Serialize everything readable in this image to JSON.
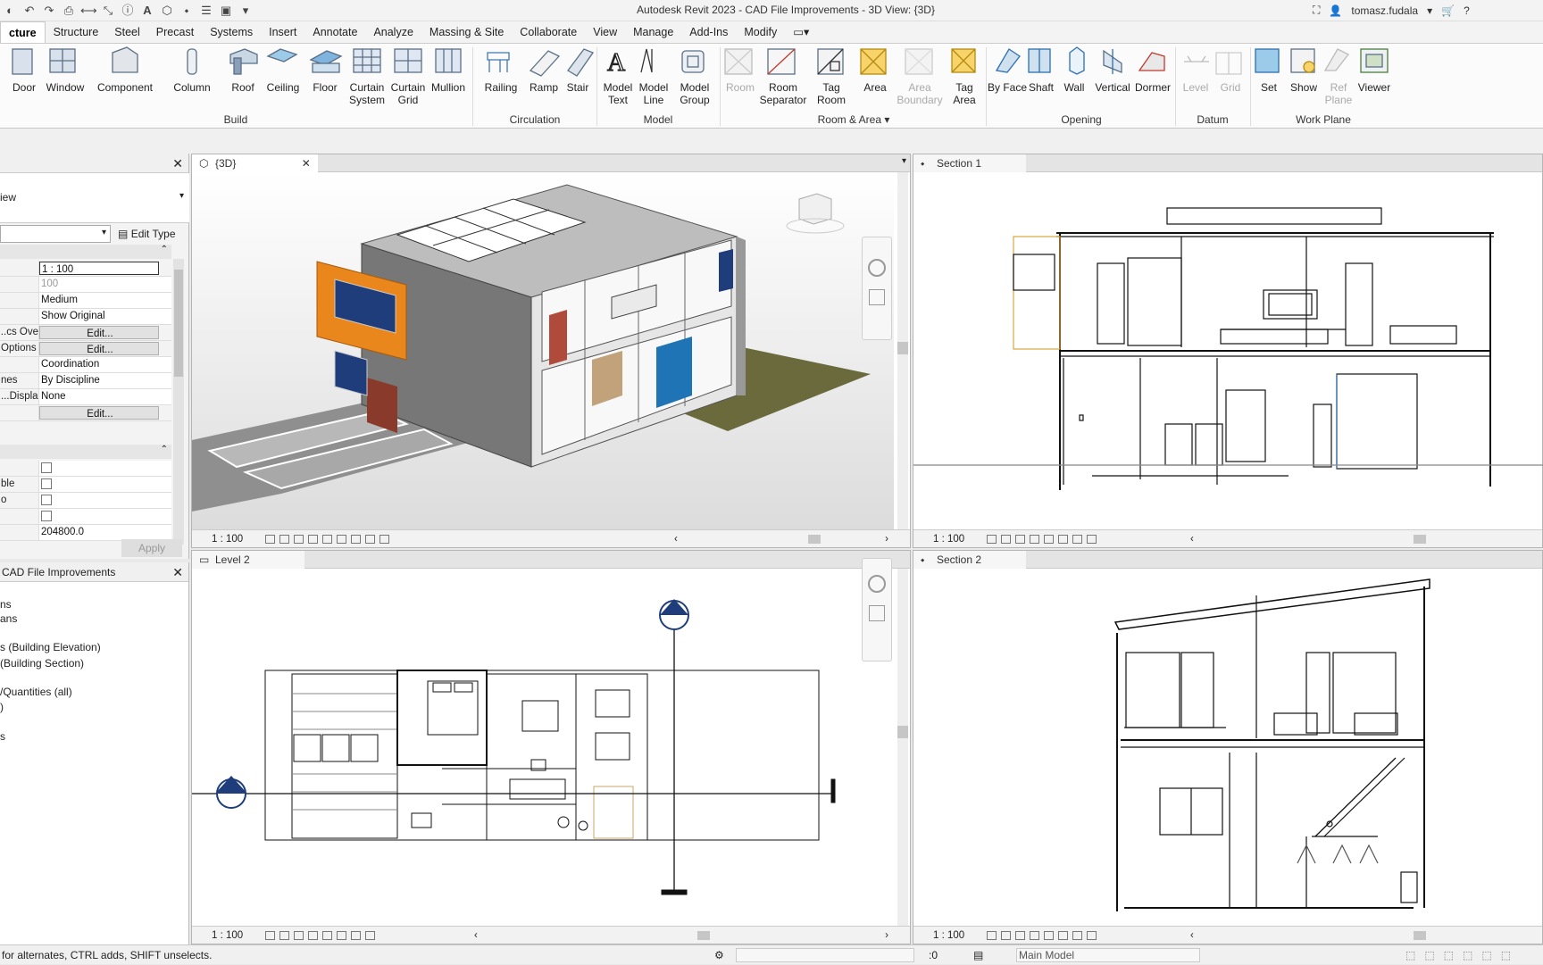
{
  "window": {
    "title": "Autodesk Revit 2023 - CAD File Improvements - 3D View: {3D}",
    "user": "tomasz.fudala"
  },
  "tabs": [
    "cture",
    "Structure",
    "Steel",
    "Precast",
    "Systems",
    "Insert",
    "Annotate",
    "Analyze",
    "Massing & Site",
    "Collaborate",
    "View",
    "Manage",
    "Add-Ins",
    "Modify"
  ],
  "ribbon": {
    "build": {
      "label": "Build",
      "items": [
        "Door",
        "Window",
        "Component",
        "Column",
        "Roof",
        "Ceiling",
        "Floor",
        "Curtain System",
        "Curtain Grid",
        "Mullion"
      ]
    },
    "circulation": {
      "label": "Circulation",
      "items": [
        "Railing",
        "Ramp",
        "Stair"
      ]
    },
    "model": {
      "label": "Model",
      "items": [
        "Model Text",
        "Model Line",
        "Model Group"
      ]
    },
    "room_area": {
      "label": "Room & Area",
      "items": [
        "Room",
        "Room Separator",
        "Tag Room",
        "Area",
        "Area Boundary",
        "Tag Area"
      ]
    },
    "opening": {
      "label": "Opening",
      "items": [
        "By Face",
        "Shaft",
        "Wall",
        "Vertical",
        "Dormer"
      ]
    },
    "datum": {
      "label": "Datum",
      "items": [
        "Level",
        "Grid"
      ]
    },
    "work_plane": {
      "label": "Work Plane",
      "items": [
        "Set",
        "Show",
        "Ref Plane",
        "Viewer"
      ]
    }
  },
  "properties": {
    "type_selector": "iew",
    "edit_type": "Edit Type",
    "rows": [
      {
        "k": "",
        "v": "1 : 100",
        "kind": "input"
      },
      {
        "k": "",
        "v": "100",
        "kind": "muted"
      },
      {
        "k": "",
        "v": "Medium"
      },
      {
        "k": "",
        "v": "Show Original"
      },
      {
        "k": "cs Ove...",
        "v": "Edit...",
        "kind": "btn"
      },
      {
        "k": "Options",
        "v": "Edit...",
        "kind": "btn"
      },
      {
        "k": "",
        "v": "Coordination"
      },
      {
        "k": "nes",
        "v": "By Discipline"
      },
      {
        "k": "Displa...",
        "v": "None"
      },
      {
        "k": "",
        "v": "Edit...",
        "kind": "btn"
      }
    ],
    "rows2": [
      {
        "k": "",
        "v": ""
      },
      {
        "k": "ble",
        "v": ""
      },
      {
        "k": "o",
        "v": ""
      },
      {
        "k": "",
        "v": ""
      },
      {
        "k": "",
        "v": "204800.0"
      }
    ],
    "apply": "Apply"
  },
  "browser": {
    "title": "CAD File Improvements",
    "items": [
      "ns",
      "ans",
      "s (Building Elevation)",
      "(Building Section)",
      "/Quantities (all)",
      ")",
      "s"
    ]
  },
  "views": {
    "v3d": {
      "tab": "{3D}",
      "scale": "1 : 100"
    },
    "section1": {
      "tab": "Section 1",
      "scale": "1 : 100"
    },
    "level2": {
      "tab": "Level 2",
      "scale": "1 : 100"
    },
    "section2": {
      "tab": "Section 2",
      "scale": "1 : 100"
    }
  },
  "status": {
    "hint": "for alternates, CTRL adds, SHIFT unselects.",
    "count": ":0",
    "model": "Main Model"
  },
  "colors": {
    "orange": "#e9861c",
    "blue": "#1f74b5",
    "navy": "#1f3d7a",
    "grass": "#6b6a3c"
  }
}
